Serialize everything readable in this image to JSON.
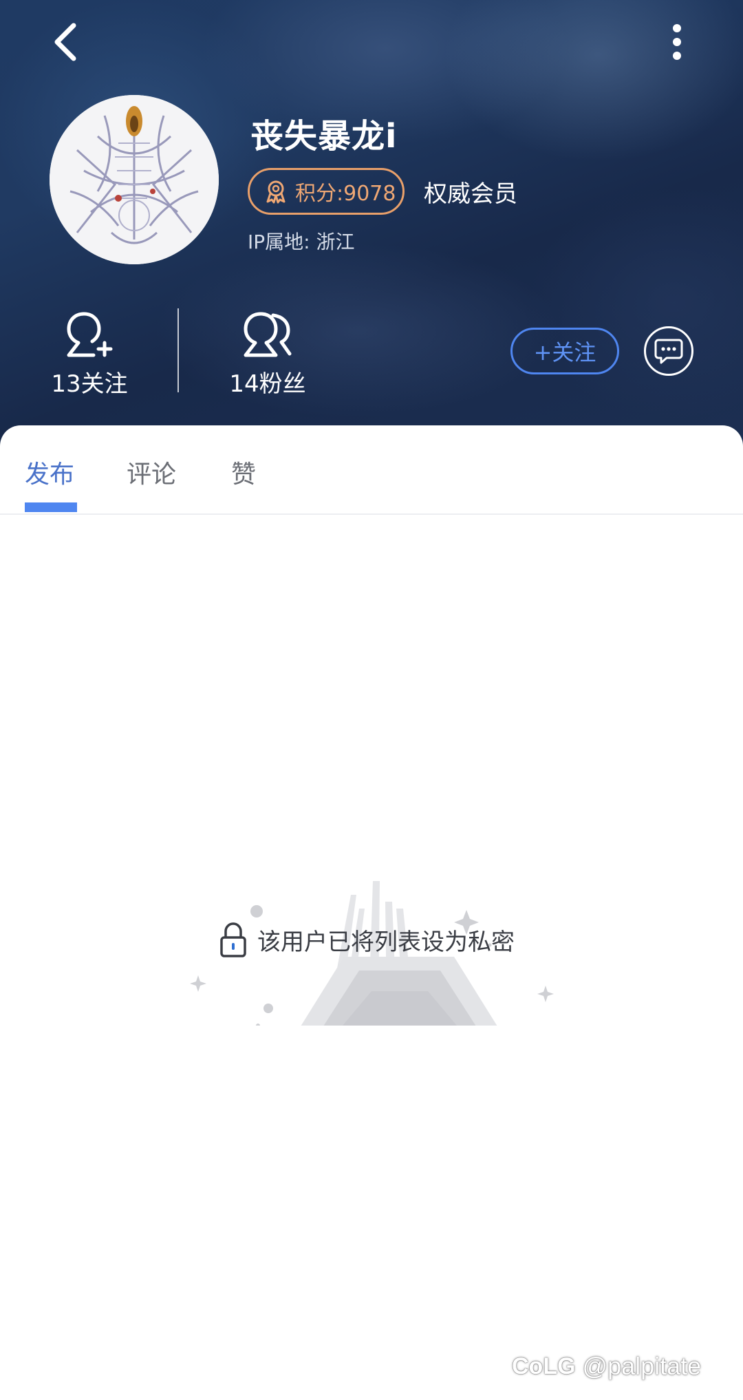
{
  "header": {
    "back_icon": "chevron-left-icon",
    "more_icon": "more-vertical-icon",
    "username": "丧失暴龙i",
    "points_label": "积分:9078",
    "member_label": "权威会员",
    "ip_location": "IP属地: 浙江",
    "following_label": "13关注",
    "fans_label": "14粉丝",
    "follow_button": "+关注",
    "message_icon": "chat-bubble-icon"
  },
  "tabs": [
    {
      "label": "发布",
      "active": true
    },
    {
      "label": "评论",
      "active": false
    },
    {
      "label": "赞",
      "active": false
    }
  ],
  "empty_state": {
    "notice": "该用户已将列表设为私密"
  },
  "watermark": {
    "logo": "CoLG",
    "handle": "@palpitate"
  },
  "colors": {
    "accent": "#4f86f0",
    "badge": "#e9a06a",
    "header_bg": "#1f3a63"
  }
}
